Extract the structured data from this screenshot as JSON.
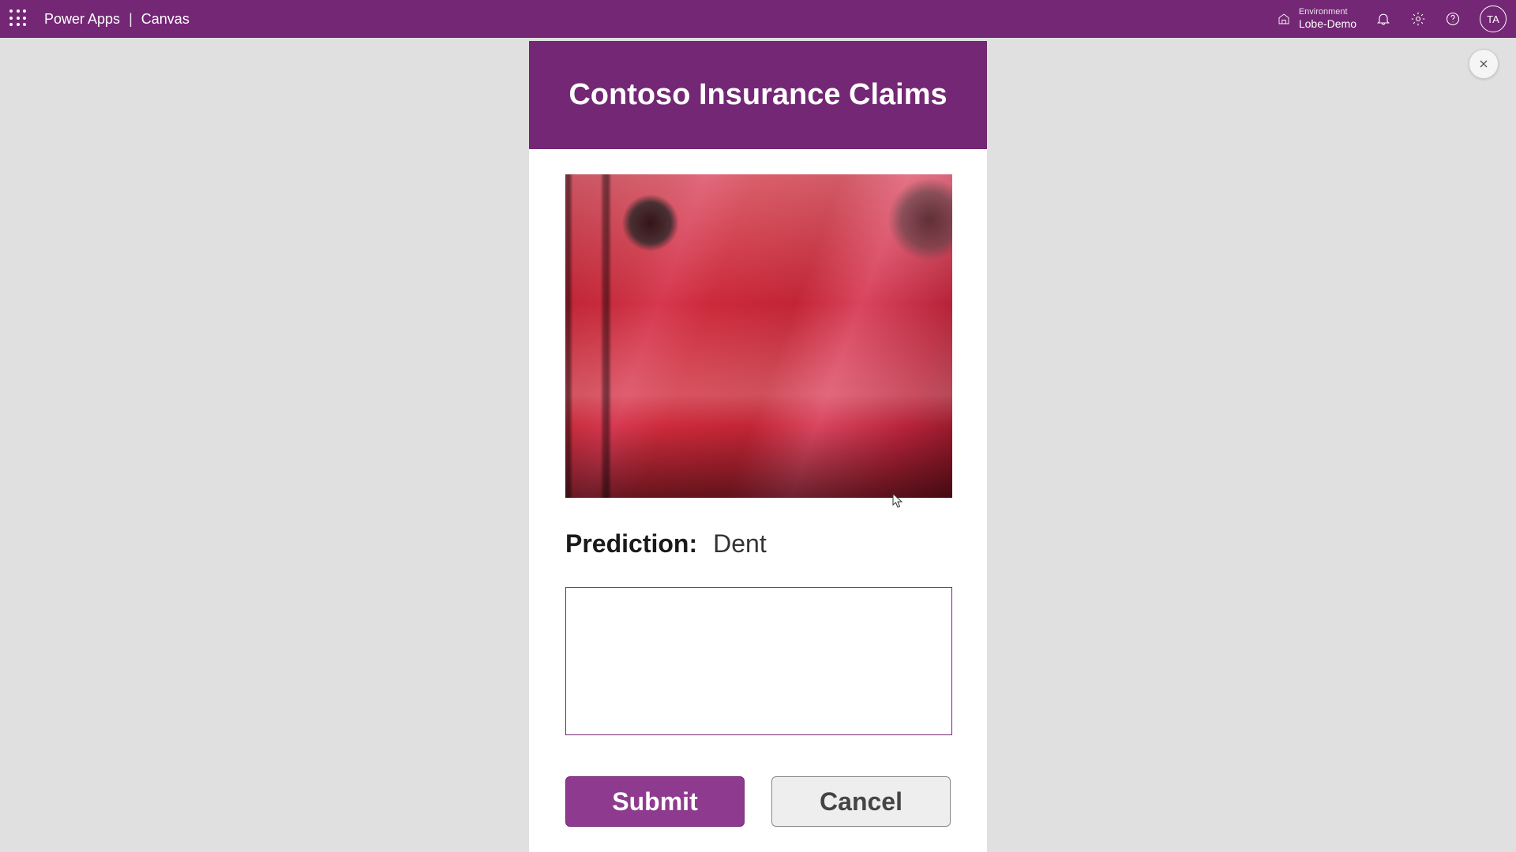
{
  "header": {
    "product": "Power Apps",
    "context": "Canvas",
    "environment_label": "Environment",
    "environment_name": "Lobe-Demo",
    "avatar_initials": "TA"
  },
  "app": {
    "title": "Contoso Insurance Claims",
    "prediction_label": "Prediction:",
    "prediction_value": "Dent",
    "comment_value": "",
    "submit_label": "Submit",
    "cancel_label": "Cancel"
  },
  "icons": {
    "waffle": "app-launcher-icon",
    "env": "environment-icon",
    "bell": "notifications-icon",
    "gear": "settings-icon",
    "help": "help-icon",
    "close": "close-icon"
  }
}
